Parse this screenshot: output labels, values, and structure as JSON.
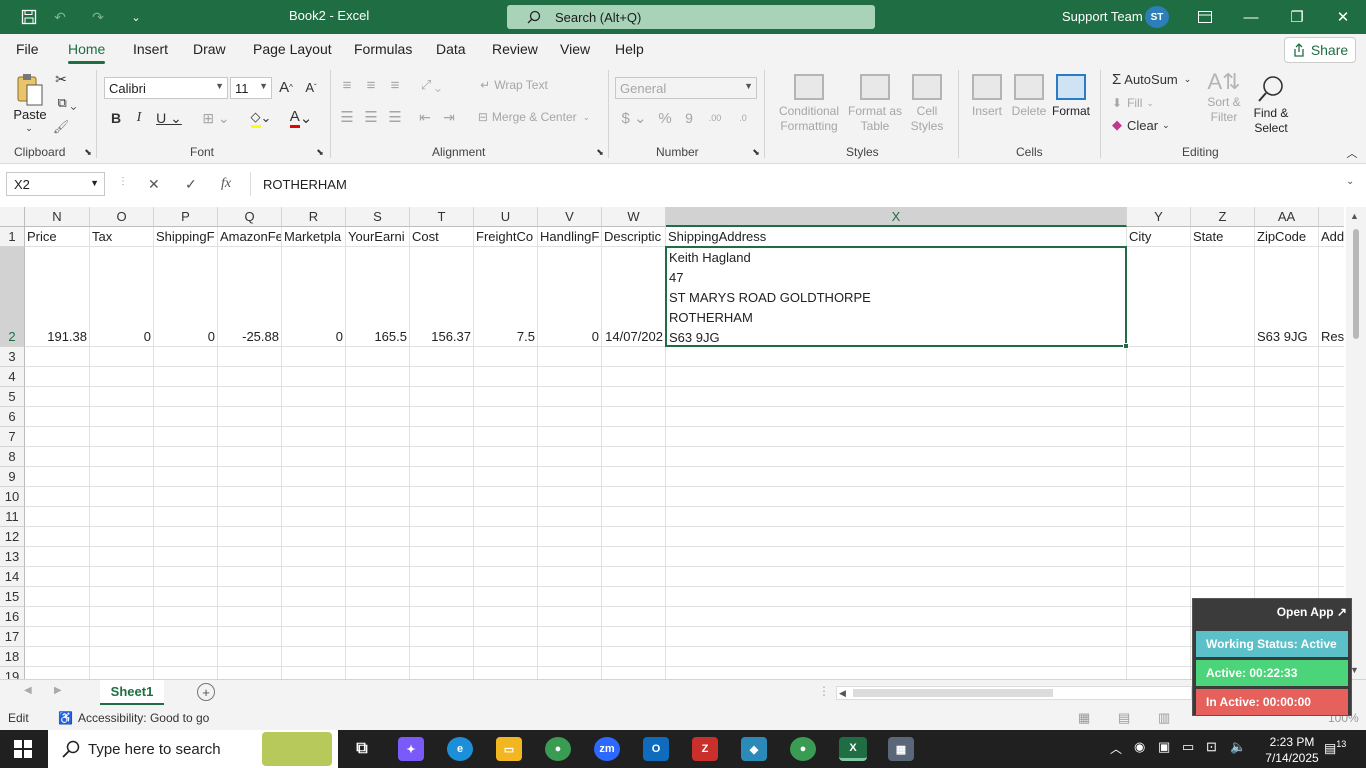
{
  "titlebar": {
    "doc_title": "Book2 - Excel",
    "search_placeholder": "Search (Alt+Q)",
    "user_name": "Support Team",
    "user_initials": "ST"
  },
  "menu": {
    "items": [
      "File",
      "Home",
      "Insert",
      "Draw",
      "Page Layout",
      "Formulas",
      "Data",
      "Review",
      "View",
      "Help"
    ],
    "active": "Home",
    "share": "Share"
  },
  "ribbon": {
    "clipboard": {
      "label": "Clipboard",
      "paste": "Paste"
    },
    "font": {
      "label": "Font",
      "name": "Calibri",
      "size": "11"
    },
    "alignment": {
      "label": "Alignment",
      "wrap": "Wrap Text",
      "merge": "Merge & Center"
    },
    "number": {
      "label": "Number",
      "format": "General"
    },
    "styles": {
      "label": "Styles",
      "conditional": "Conditional Formatting",
      "format_table": "Format as Table",
      "cell_styles": "Cell Styles"
    },
    "cells": {
      "label": "Cells",
      "insert": "Insert",
      "delete": "Delete",
      "format": "Format"
    },
    "editing": {
      "label": "Editing",
      "autosum": "AutoSum",
      "fill": "Fill",
      "clear": "Clear",
      "sort": "Sort & Filter",
      "find": "Find & Select"
    }
  },
  "formula_bar": {
    "name_box": "X2",
    "fx": "fx",
    "value": "ROTHERHAM"
  },
  "grid": {
    "columns": [
      "N",
      "O",
      "P",
      "Q",
      "R",
      "S",
      "T",
      "U",
      "V",
      "W",
      "X",
      "Y",
      "Z",
      "AA",
      "A"
    ],
    "rows": [
      "1",
      "2",
      "3",
      "4",
      "5",
      "6",
      "7",
      "8",
      "9",
      "10",
      "11",
      "12",
      "13",
      "14",
      "15",
      "16",
      "17",
      "18",
      "19"
    ],
    "row1": [
      "Price",
      "Tax",
      "ShippingF",
      "AmazonFe",
      "Marketpla",
      "YourEarni",
      "Cost",
      "FreightCo",
      "HandlingF",
      "Descriptic",
      "ShippingAddress",
      "City",
      "State",
      "ZipCode",
      "Add"
    ],
    "row2": [
      "191.38",
      "0",
      "0",
      "-25.88",
      "0",
      "165.5",
      "156.37",
      "7.5",
      "0",
      "14/07/202",
      "",
      "",
      "",
      "S63 9JG",
      "Res"
    ],
    "address_lines": [
      "Keith Hagland",
      "47",
      "ST MARYS ROAD GOLDTHORPE",
      "ROTHERHAM",
      "S63 9JG"
    ]
  },
  "sheet": {
    "tab": "Sheet1"
  },
  "status": {
    "mode": "Edit",
    "accessibility": "Accessibility: Good to go",
    "zoom": "100%"
  },
  "widget": {
    "open": "Open App ↗",
    "working": "Working Status: Active",
    "active": "Active: 00:22:33",
    "inactive": "In Active: 00:00:00"
  },
  "taskbar": {
    "search": "Type here to search",
    "time": "2:23 PM",
    "date": "7/14/2025",
    "notifications": "13"
  },
  "colors": {
    "excel_green": "#1f6e43",
    "working": "#5bc0c8",
    "active": "#4cd47a",
    "inactive": "#e6605c"
  }
}
